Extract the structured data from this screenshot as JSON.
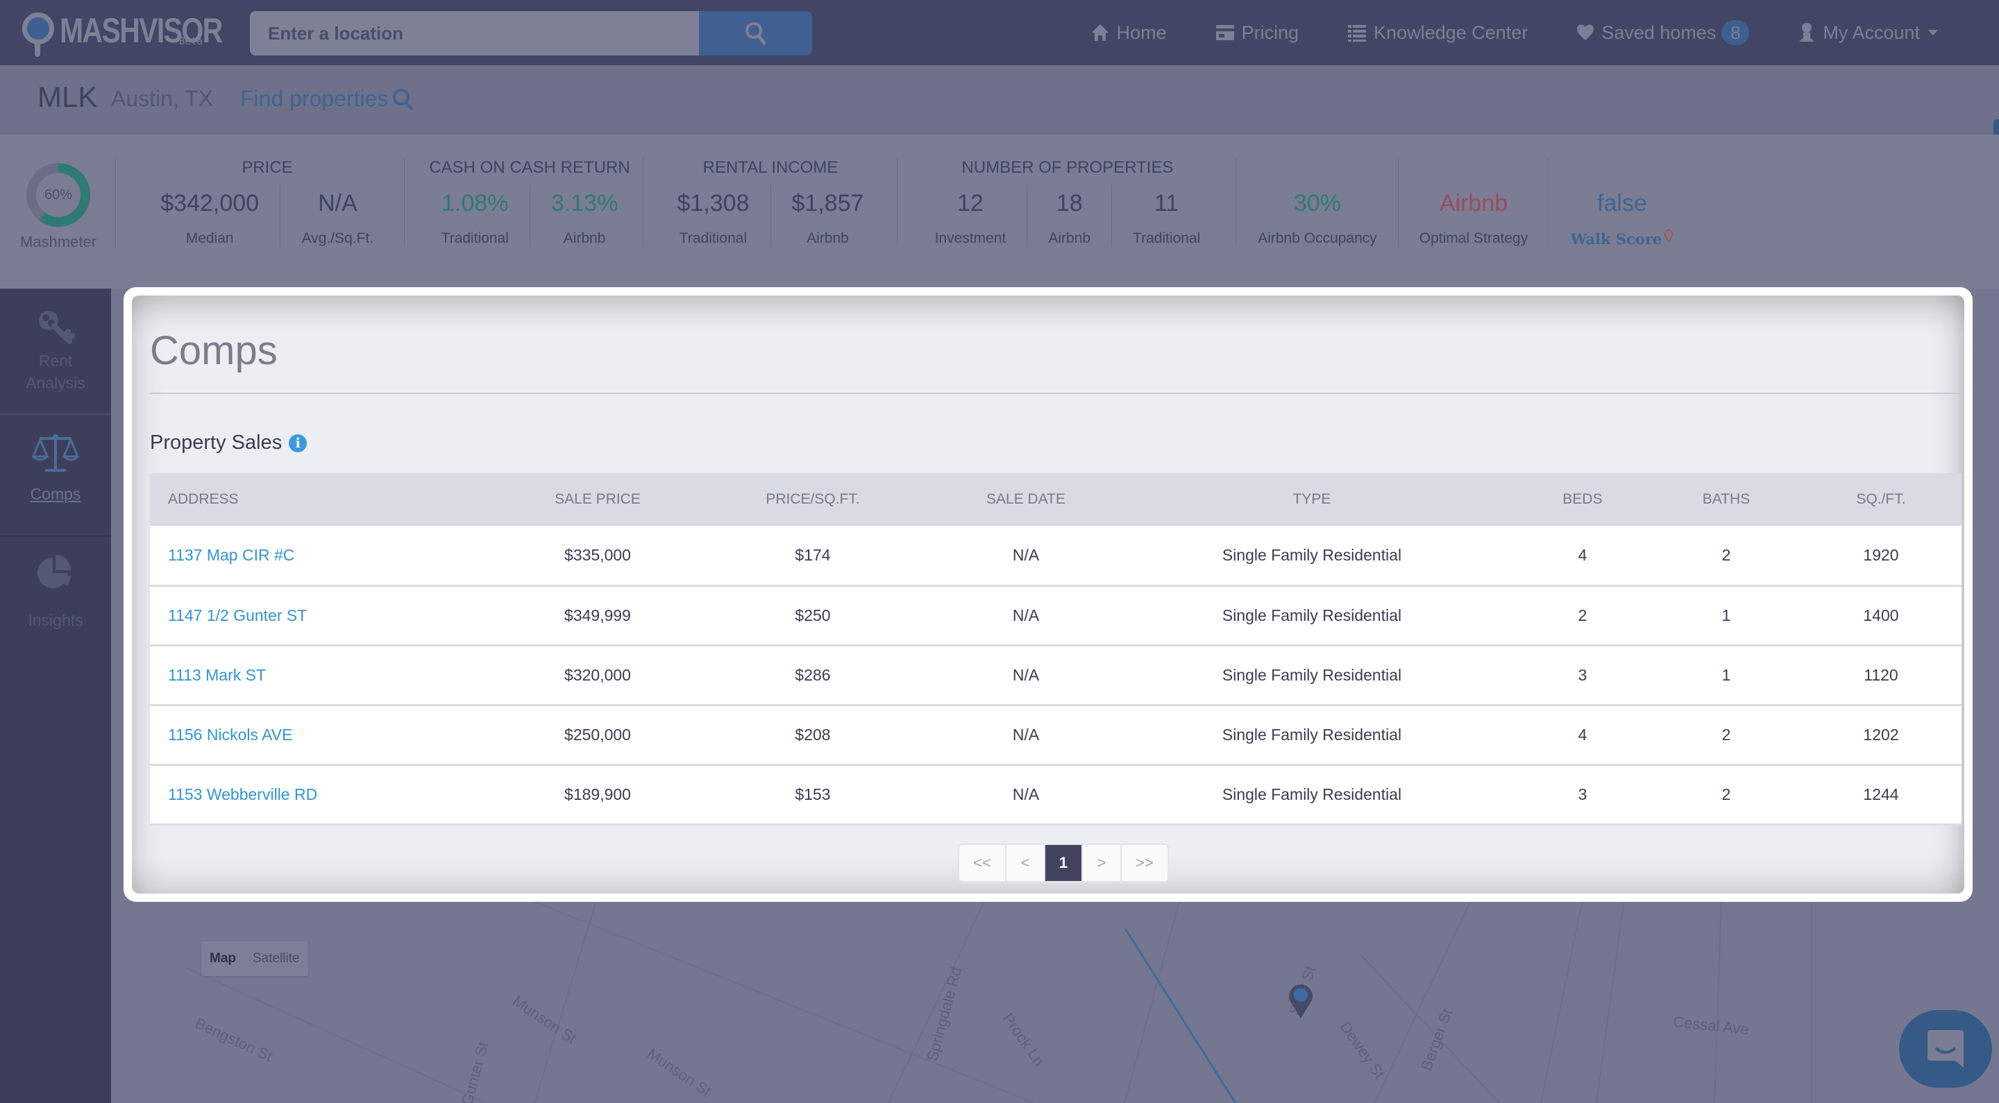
{
  "nav": {
    "logo": "MASHVISOR",
    "logo_badge": "Beta",
    "search_placeholder": "Enter a location",
    "links": {
      "home": "Home",
      "pricing": "Pricing",
      "knowledge": "Knowledge Center",
      "saved": "Saved homes",
      "saved_count": "8",
      "account": "My Account"
    }
  },
  "location": {
    "name": "MLK",
    "city": "Austin, TX",
    "find_label": "Find properties"
  },
  "stats": {
    "mashmeter": {
      "value": "60%",
      "fraction": 0.6,
      "label": "Mashmeter"
    },
    "price": {
      "title": "PRICE",
      "median": "$342,000",
      "median_label": "Median",
      "avg": "N/A",
      "avg_label": "Avg./Sq.Ft."
    },
    "coc": {
      "title": "CASH ON CASH RETURN",
      "traditional": "1.08%",
      "traditional_label": "Traditional",
      "airbnb": "3.13%",
      "airbnb_label": "Airbnb"
    },
    "rental": {
      "title": "RENTAL INCOME",
      "traditional": "$1,308",
      "traditional_label": "Traditional",
      "airbnb": "$1,857",
      "airbnb_label": "Airbnb"
    },
    "properties": {
      "title": "NUMBER OF PROPERTIES",
      "investment": "12",
      "investment_label": "Investment",
      "airbnb": "18",
      "airbnb_label": "Airbnb",
      "traditional": "11",
      "traditional_label": "Traditional"
    },
    "occupancy": {
      "value": "30%",
      "label": "Airbnb Occupancy"
    },
    "strategy": {
      "value": "Airbnb",
      "label": "Optimal Strategy"
    },
    "walkscore": {
      "value": "false",
      "label": "Walk Score"
    }
  },
  "sidebar": {
    "items": [
      {
        "label_1": "Rent",
        "label_2": "Analysis"
      },
      {
        "label_1": "Comps"
      },
      {
        "label_1": "Insights"
      }
    ]
  },
  "modal": {
    "title": "Comps",
    "section": "Property Sales",
    "columns": [
      "ADDRESS",
      "SALE PRICE",
      "PRICE/SQ.FT.",
      "SALE DATE",
      "TYPE",
      "BEDS",
      "BATHS",
      "SQ./FT."
    ],
    "rows": [
      [
        "1137 Map CIR #C",
        "$335,000",
        "$174",
        "N/A",
        "Single Family Residential",
        "4",
        "2",
        "1920"
      ],
      [
        "1147 1/2 Gunter ST",
        "$349,999",
        "$250",
        "N/A",
        "Single Family Residential",
        "2",
        "1",
        "1400"
      ],
      [
        "1113 Mark ST",
        "$320,000",
        "$286",
        "N/A",
        "Single Family Residential",
        "3",
        "1",
        "1120"
      ],
      [
        "1156 Nickols AVE",
        "$250,000",
        "$208",
        "N/A",
        "Single Family Residential",
        "4",
        "2",
        "1202"
      ],
      [
        "1153 Webberville RD",
        "$189,900",
        "$153",
        "N/A",
        "Single Family Residential",
        "3",
        "2",
        "1244"
      ]
    ],
    "pager": {
      "first": "<<",
      "prev": "<",
      "current": "1",
      "next": ">",
      "last": ">>"
    }
  },
  "map": {
    "toggle_map": "Map",
    "toggle_satellite": "Satellite",
    "streets": [
      "Bengston St",
      "Munson St",
      "Munson St",
      "Gunter St",
      "Springdale Rd",
      "Prock Ln",
      "Spur St",
      "Dewey St",
      "Berger St",
      "Cessal Ave"
    ]
  }
}
